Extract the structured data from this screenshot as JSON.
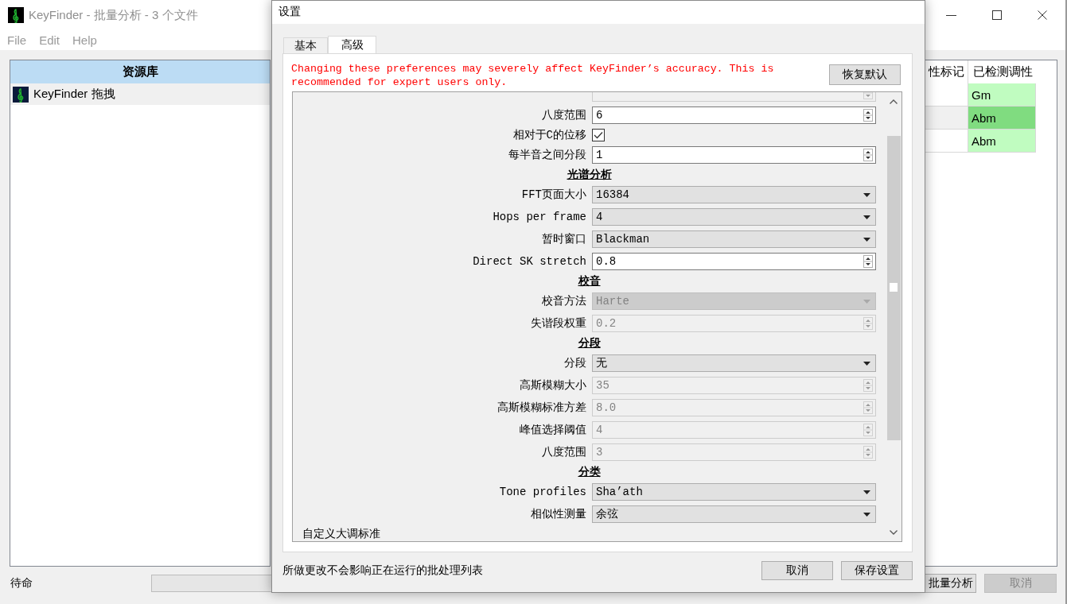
{
  "main_window": {
    "title": "KeyFinder - 批量分析 - 3 个文件",
    "menu": [
      "File",
      "Edit",
      "Help"
    ],
    "library": {
      "heading": "资源库",
      "items": [
        {
          "label": "KeyFinder 拖拽",
          "selected": true
        }
      ]
    },
    "table": {
      "columns": [
        "性标记",
        "已检测调性"
      ],
      "rows": [
        {
          "detected_key": "Gm",
          "color": "#c0fcc0"
        },
        {
          "detected_key": "Abm",
          "color": "#80dc80"
        },
        {
          "detected_key": "Abm",
          "color": "#c0fcc0"
        }
      ]
    },
    "status": "待命",
    "progress_bar": {
      "level": 0
    },
    "buttons": [
      {
        "label": "批量分析",
        "disabled": false
      },
      {
        "label": "取消",
        "disabled": true
      }
    ]
  },
  "dialog": {
    "title": "设置",
    "tabs": [
      {
        "label": "基本",
        "selected": false
      },
      {
        "label": "高级",
        "selected": true
      }
    ],
    "warning": "Changing these preferences may severely affect KeyFinder’s accuracy. This is recommended for expert users only.",
    "reset_button": "恢复默认",
    "rows": [
      {
        "kind": "spin",
        "disabled": true
      },
      {
        "kind": "spin",
        "label": "八度范围",
        "value": "6",
        "disabled": false
      },
      {
        "kind": "check",
        "label": "相对于C的位移",
        "checked": true
      },
      {
        "kind": "spin",
        "label": "每半音之间分段",
        "value": "1",
        "disabled": false
      },
      {
        "kind": "heading",
        "label": "光谱分析"
      },
      {
        "kind": "combo",
        "label": "FFT页面大小",
        "value": "16384",
        "disabled": false
      },
      {
        "kind": "combo",
        "label": "Hops per frame",
        "value": "4",
        "disabled": false
      },
      {
        "kind": "combo",
        "label": "暂时窗口",
        "value": "Blackman",
        "disabled": false
      },
      {
        "kind": "spin",
        "label": "Direct SK stretch",
        "value": "0.8",
        "disabled": false
      },
      {
        "kind": "heading",
        "label": "校音"
      },
      {
        "kind": "combo",
        "label": "校音方法",
        "value": "Harte",
        "disabled": true
      },
      {
        "kind": "spin",
        "label": "失谐段权重",
        "value": "0.2",
        "disabled": true
      },
      {
        "kind": "heading",
        "label": "分段"
      },
      {
        "kind": "combo",
        "label": "分段",
        "value": "无",
        "disabled": false
      },
      {
        "kind": "spin",
        "label": "高斯模糊大小",
        "value": "35",
        "disabled": true
      },
      {
        "kind": "spin",
        "label": "高斯模糊标准方差",
        "value": "8.0",
        "disabled": true
      },
      {
        "kind": "spin",
        "label": "峰值选择阈值",
        "value": "4",
        "disabled": true
      },
      {
        "kind": "spin",
        "label": "八度范围",
        "value": "3",
        "disabled": true
      },
      {
        "kind": "heading",
        "label": "分类"
      },
      {
        "kind": "combo",
        "label": "Tone profiles",
        "value": "Sha’ath",
        "disabled": false
      },
      {
        "kind": "combo",
        "label": "相似性测量",
        "value": "余弦",
        "disabled": false
      },
      {
        "kind": "group_label",
        "label": "自定义大调标准"
      }
    ],
    "note": "所做更改不会影响正在运行的批处理列表",
    "buttons": [
      "取消",
      "保存设置"
    ]
  }
}
